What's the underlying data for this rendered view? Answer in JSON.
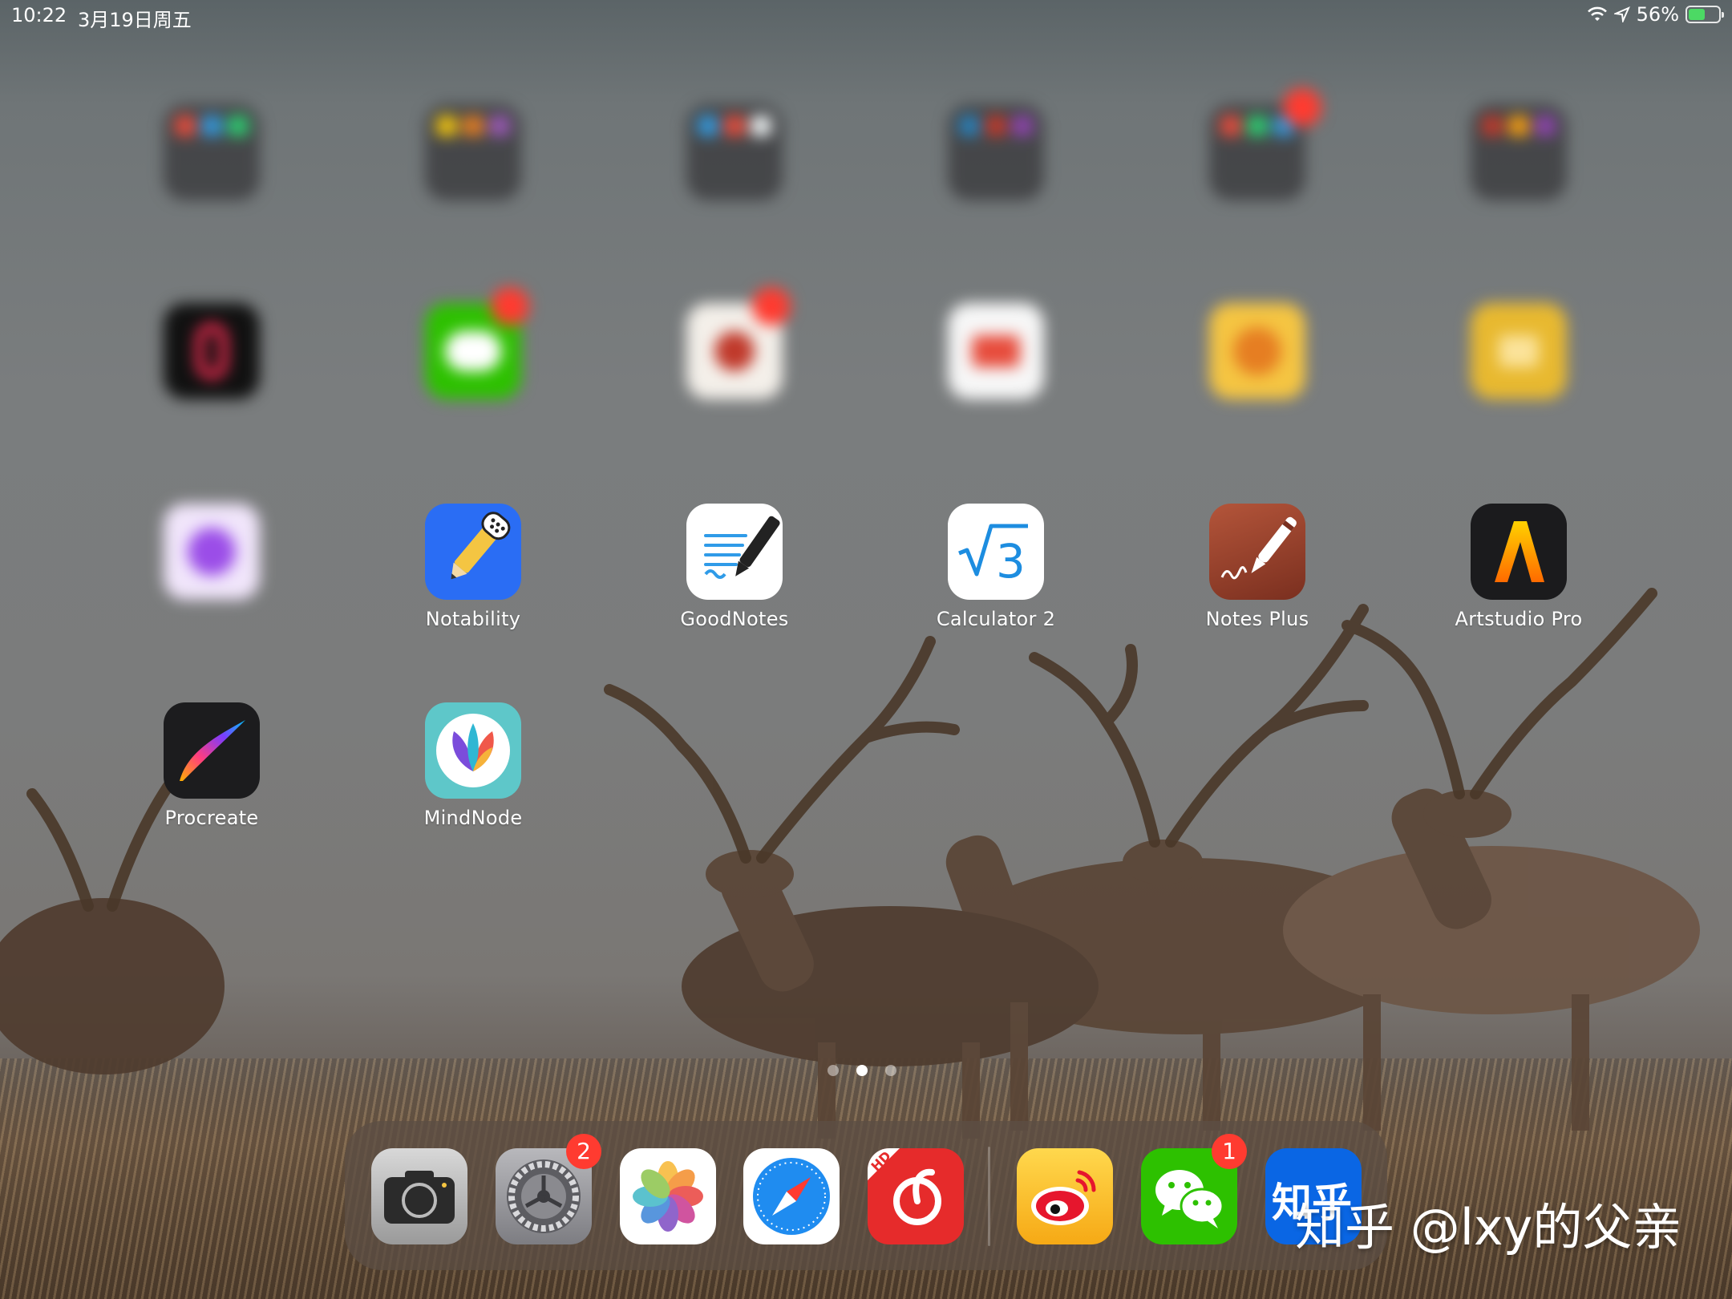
{
  "status_bar": {
    "time": "10:22",
    "date": "3月19日周五",
    "battery_percent": "56%",
    "battery_level": 0.56,
    "charging": true,
    "icons": [
      "wifi-icon",
      "location-arrow-icon",
      "battery-charging-icon"
    ]
  },
  "apps": [
    {
      "label": "Notability",
      "icon": "notability-icon"
    },
    {
      "label": "GoodNotes",
      "icon": "goodnotes-icon"
    },
    {
      "label": "Calculator 2",
      "icon": "calculator2-icon"
    },
    {
      "label": "Notes Plus",
      "icon": "notes-plus-icon"
    },
    {
      "label": "Artstudio Pro",
      "icon": "artstudio-pro-icon"
    },
    {
      "label": "Procreate",
      "icon": "procreate-icon"
    },
    {
      "label": "MindNode",
      "icon": "mindnode-icon"
    }
  ],
  "page_indicator": {
    "pages": 3,
    "current": 2
  },
  "dock": {
    "apps": [
      {
        "icon": "camera-icon"
      },
      {
        "icon": "settings-icon",
        "badge": "2"
      },
      {
        "icon": "photos-icon"
      },
      {
        "icon": "safari-icon"
      },
      {
        "icon": "netease-music-hd-icon"
      },
      {
        "icon": "weibo-icon"
      },
      {
        "icon": "wechat-icon",
        "badge": "1"
      },
      {
        "icon": "zhihu-icon"
      }
    ],
    "netease_hd_text": "HD",
    "zhihu_text": "知乎"
  },
  "watermark": "知乎 @lxy的父亲",
  "colors": {
    "badge": "#ff3b30",
    "notability_blue": "#2a6df4",
    "wechat_green": "#2dc100",
    "zhihu_blue": "#0a66e4"
  }
}
